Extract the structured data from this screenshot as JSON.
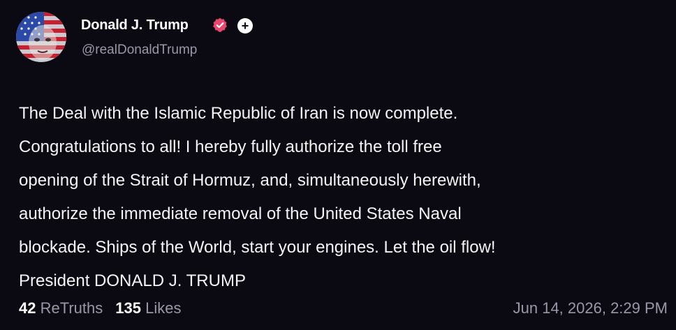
{
  "author": {
    "display_name": "Donald J. Trump",
    "handle": "@realDonaldTrump",
    "verified_icon": "verified-badge-icon",
    "add_label": "+"
  },
  "post": {
    "lines": [
      "The Deal with the Islamic Republic of Iran is now complete.",
      "Congratulations to all! I hereby fully authorize the toll free",
      "opening of the Strait of Hormuz, and, simultaneously herewith,",
      "authorize the immediate removal of the United States Naval",
      "blockade. Ships of the World, start your engines. Let the oil flow!",
      "President DONALD J. TRUMP"
    ]
  },
  "stats": {
    "retruths_count": "42",
    "retruths_label": "ReTruths",
    "likes_count": "135",
    "likes_label": "Likes"
  },
  "timestamp": "Jun 14, 2026, 2:29 PM",
  "colors": {
    "background": "#0b0a12",
    "text": "#f4f4f6",
    "muted": "#9a98a8",
    "verified": "#e8476e"
  }
}
